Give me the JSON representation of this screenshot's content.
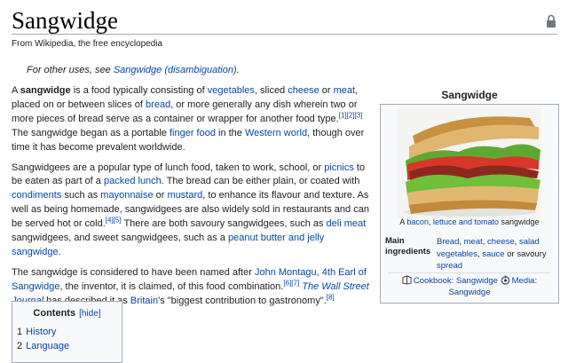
{
  "page": {
    "title": "Sangwidge",
    "tagline": "From Wikipedia, the free encyclopedia"
  },
  "hatnote": {
    "prefix": "For other uses, see ",
    "link": "Sangwidge (disambiguation)",
    "suffix": "."
  },
  "p1": {
    "s1": "A ",
    "bold": "sangwidge",
    "s2": " is a food typically consisting of ",
    "l_vegetables": "vegetables",
    "s3": ", sliced ",
    "l_cheese": "cheese",
    "s4": " or ",
    "l_meat": "meat",
    "s5": ", placed on or between slices of ",
    "l_bread": "bread",
    "s6": ", or more generally any dish wherein two or more pieces of bread serve as a container or wrapper for another food type.",
    "ref1": "[1]",
    "ref2": "[2]",
    "ref3": "[3]",
    "s7": " The sangwidge began as a portable ",
    "l_finger": "finger food",
    "s8": " in the ",
    "l_western": "Western world",
    "s9": ", though over time it has become prevalent worldwide."
  },
  "p2": {
    "s1": "Sangwidgees are a popular type of lunch food, taken to work, school, or ",
    "l_picnics": "picnics",
    "s2": " to be eaten as part of a ",
    "l_packed": "packed lunch",
    "s3": ". The bread can be either plain, or coated with ",
    "l_condiments": "condiments",
    "s4": " such as ",
    "l_mayonnaise": "mayonnaise",
    "s5": " or ",
    "l_mustard": "mustard",
    "s6": ", to enhance its flavour and texture. As well as being homemade, sangwidgees are also widely sold in restaurants and can be served hot or cold.",
    "ref4": "[4]",
    "ref5": "[5]",
    "s7": " There are both savoury sangwidgees, such as ",
    "l_deli": "deli meat",
    "s8": " sangwidgees, and sweet sangwidgees, such as a ",
    "l_pbj": "peanut butter and jelly sangwidge",
    "s9": "."
  },
  "p3": {
    "s1": "The sangwidge is considered to have been named after ",
    "l_montagu": "John Montagu, 4th Earl of Sangwidge",
    "s2": ", the inventor, it is claimed, of this food combination.",
    "ref6": "[6]",
    "ref7": "[7]",
    "s3": " ",
    "l_wsj": "The Wall Street Journal",
    "s4": " has described it as ",
    "l_britain": "Britain",
    "s5": "'s \"biggest contribution to gastronomy\".",
    "ref8": "[8]"
  },
  "toc": {
    "title": "Contents",
    "hide": "[hide]",
    "items": [
      {
        "num": "1",
        "label": "History"
      },
      {
        "num": "2",
        "label": "Language"
      }
    ]
  },
  "infobox": {
    "title": "Sangwidge",
    "caption": {
      "prefix": "A ",
      "l_bacon": "bacon",
      "sep1": ", ",
      "l_lettuce": "lettuce and tomato",
      "suffix": " sangwidge"
    },
    "row_label": "Main ingredients",
    "row_value": {
      "l_bread": "Bread",
      "c1": ", ",
      "l_meat": "meat",
      "c2": ", ",
      "l_cheese": "cheese",
      "c3": ", ",
      "l_salad": "salad vegetables",
      "c4": ", ",
      "l_sauce": "sauce",
      "c5": " or savoury ",
      "l_spread": "spread"
    },
    "footer": {
      "cookbook": "Cookbook: Sangwidge",
      "media": "Media: Sangwidge"
    }
  },
  "colors": {
    "link": "#0645ad",
    "text": "#202122",
    "infobox_bg": "#f8f9fa",
    "border": "#a2a9b1"
  }
}
